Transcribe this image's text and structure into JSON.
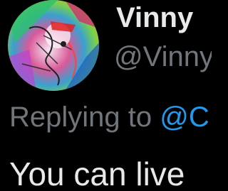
{
  "tweet": {
    "author": {
      "display_name": "Vinny",
      "handle": "@Vinny"
    },
    "reply": {
      "prefix": "Replying to ",
      "handle": "@C"
    },
    "text": "You can live"
  },
  "colors": {
    "background": "#000000",
    "primary_text": "#e7e9ea",
    "secondary_text": "#71767b",
    "accent": "#1d9bf0"
  }
}
